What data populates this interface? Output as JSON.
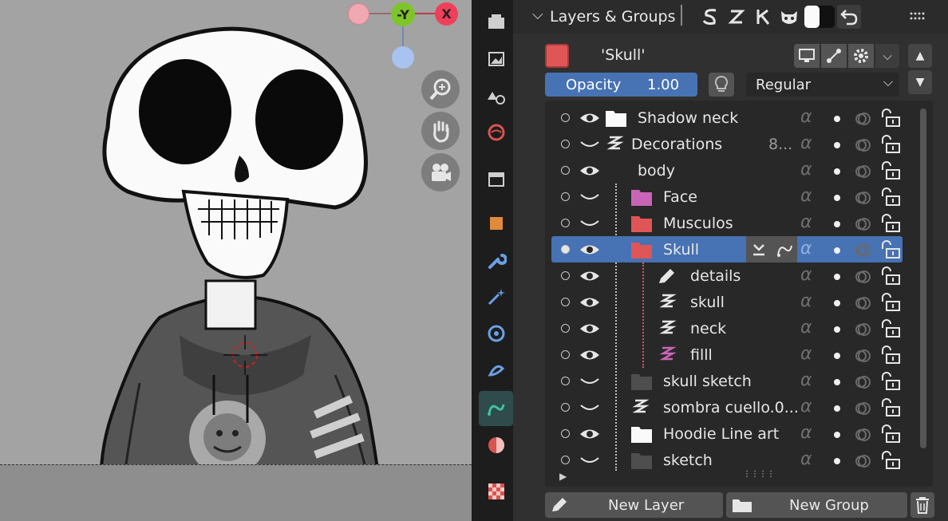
{
  "viewport": {
    "gizmo": {
      "neg_y_label": "-Y",
      "x_label": "X"
    },
    "nav_icons": [
      "zoom-icon",
      "hand-pan-icon",
      "camera-icon"
    ]
  },
  "properties_tabs": [
    "render-icon",
    "output-icon",
    "view-layer-icon",
    "scene-icon",
    "world-icon",
    "collection-icon",
    "object-icon",
    "modifier-icon",
    "shader-fx-icon",
    "physics-icon",
    "constraints-icon",
    "object-data-icon",
    "material-icon",
    "texture-icon"
  ],
  "panel": {
    "title": "Layers & Groups",
    "selected_layer_name": "'Skull'",
    "opacity_label": "Opacity",
    "opacity_value": "1.00",
    "blend_mode": "Regular",
    "layers": [
      {
        "name": "Shadow neck",
        "type": "group-white",
        "visible": true
      },
      {
        "name": "Decorations",
        "type": "stroke",
        "visible": false,
        "badge": "8..."
      },
      {
        "name": "body",
        "type": "none",
        "visible": true
      },
      {
        "name": "Face",
        "type": "group-pink",
        "visible": false,
        "indent": 1
      },
      {
        "name": "Musculos",
        "type": "group-red",
        "visible": false,
        "indent": 1
      },
      {
        "name": "Skull",
        "type": "group-red",
        "visible": true,
        "indent": 1,
        "active": true
      },
      {
        "name": "details",
        "type": "pencil",
        "visible": true,
        "indent": 2
      },
      {
        "name": "skull",
        "type": "stroke",
        "visible": true,
        "indent": 2
      },
      {
        "name": "neck",
        "type": "stroke",
        "visible": true,
        "indent": 2
      },
      {
        "name": "filll",
        "type": "stroke-pink",
        "visible": true,
        "indent": 2
      },
      {
        "name": "skull sketch",
        "type": "group-dark",
        "visible": false,
        "indent": 1
      },
      {
        "name": "sombra cuello.0...",
        "type": "stroke",
        "visible": false,
        "indent": 1
      },
      {
        "name": "Hoodie Line art",
        "type": "group-white",
        "visible": true,
        "indent": 1
      },
      {
        "name": "sketch",
        "type": "group-dark",
        "visible": false,
        "indent": 1
      }
    ],
    "new_layer_label": "New Layer",
    "new_group_label": "New Group"
  },
  "colors": {
    "accent": "#4772b3",
    "panel_bg": "#303030",
    "list_bg": "#282828",
    "red_folder": "#e05656",
    "pink_folder": "#c865b6"
  }
}
